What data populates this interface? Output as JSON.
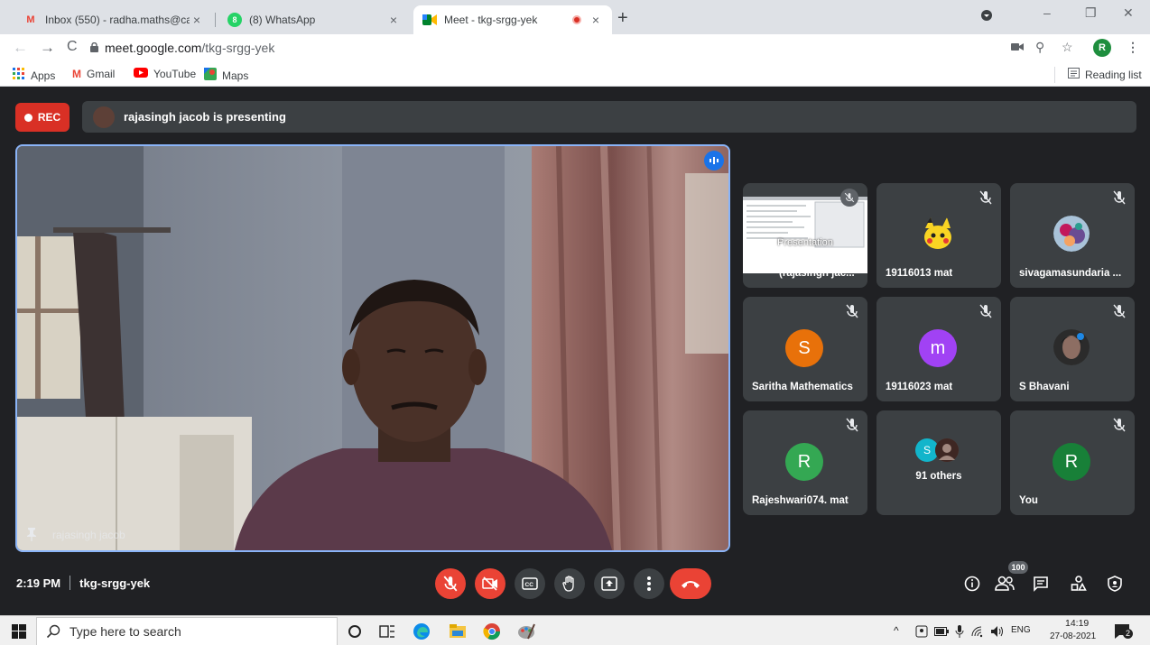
{
  "browser": {
    "tabs": [
      {
        "title": "Inbox (550) - radha.maths@cauv",
        "favicon": "gmail-icon"
      },
      {
        "title": "(8) WhatsApp",
        "favicon": "whatsapp-icon"
      },
      {
        "title": "Meet - tkg-srgg-yek",
        "favicon": "meet-icon",
        "active": true
      }
    ],
    "close_glyph": "×",
    "new_tab_glyph": "+",
    "url_host": "meet.google.com",
    "url_path": "/tkg-srgg-yek",
    "profile_initial": "R",
    "bookmarks": [
      {
        "label": "Apps",
        "icon": "apps-grid-icon"
      },
      {
        "label": "Gmail",
        "icon": "gmail-icon"
      },
      {
        "label": "YouTube",
        "icon": "youtube-icon"
      },
      {
        "label": "Maps",
        "icon": "maps-icon"
      }
    ],
    "reading_list": "Reading list"
  },
  "meet": {
    "rec_label": "REC",
    "presenting_text": "rajasingh jacob is presenting",
    "presenter_name": "rajasingh jacob",
    "presentation_tile": {
      "overlay": "Presentation",
      "name": "(rajasingh jac..."
    },
    "participants": [
      {
        "name": "19116013 mat",
        "avatar": "photo",
        "muted": true
      },
      {
        "name": "sivagamasundaria ...",
        "avatar": "photo",
        "muted": true
      },
      {
        "name": "Saritha Mathematics",
        "initial": "S",
        "color": "#e8710a",
        "muted": true
      },
      {
        "name": "19116023 mat",
        "initial": "m",
        "color": "#a142f4",
        "muted": true
      },
      {
        "name": "S Bhavani",
        "avatar": "photo",
        "muted": true
      },
      {
        "name": "Rajeshwari074. mat",
        "initial": "R",
        "color": "#34a853",
        "muted": true
      },
      {
        "name": "You",
        "initial": "R",
        "color": "#188038",
        "muted": true
      }
    ],
    "others": {
      "label": "91 others",
      "initial": "S",
      "color": "#12b5cb"
    },
    "time": "2:19 PM",
    "meeting_code": "tkg-srgg-yek",
    "people_count": "100",
    "colors": {
      "accent": "#8ab4f8",
      "danger": "#ea4335",
      "rec": "#d93025",
      "bg": "#202124",
      "tile": "#3c4043"
    }
  },
  "taskbar": {
    "search_placeholder": "Type here to search",
    "language": "ENG",
    "clock_time": "14:19",
    "clock_date": "27-08-2021",
    "notification_count": "2"
  }
}
